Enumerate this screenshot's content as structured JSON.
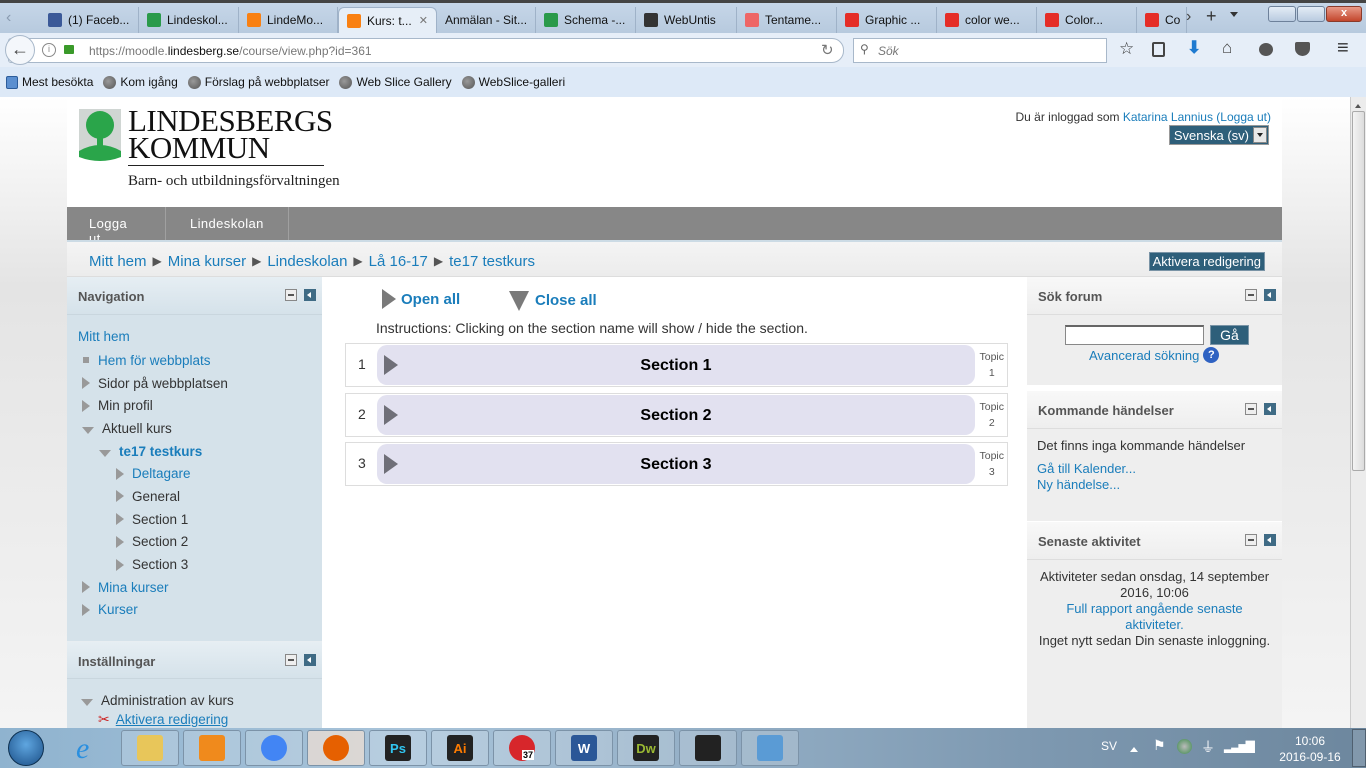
{
  "browser": {
    "tabs": [
      {
        "label": "(1) Faceb...",
        "icon": "facebook-icon",
        "color": "#3b5998"
      },
      {
        "label": "Lindeskol...",
        "icon": "lindesberg-tree-icon",
        "color": "#2a9a4a"
      },
      {
        "label": "LindeMo...",
        "icon": "moodle-icon",
        "color": "#f98012"
      },
      {
        "label": "Kurs: t...",
        "icon": "moodle-icon",
        "color": "#f98012",
        "active": true
      },
      {
        "label": "Anmälan - Sit...",
        "icon": "",
        "color": ""
      },
      {
        "label": "Schema -...",
        "icon": "lindesberg-tree-icon",
        "color": "#2a9a4a"
      },
      {
        "label": "WebUntis",
        "icon": "clock-icon",
        "color": "#333"
      },
      {
        "label": "Tentame...",
        "icon": "dots-icon",
        "color": "#e66"
      },
      {
        "label": "Graphic ...",
        "icon": "youtube-icon",
        "color": "#e52d27"
      },
      {
        "label": "color we...",
        "icon": "youtube-icon",
        "color": "#e52d27"
      },
      {
        "label": "Color...",
        "icon": "youtube-icon",
        "color": "#e52d27"
      },
      {
        "label": "Co",
        "icon": "youtube-icon",
        "color": "#e52d27"
      }
    ],
    "url_prefix": "https://moodle.",
    "url_domain": "lindesberg.se",
    "url_path": "/course/view.php?id=361",
    "search_placeholder": "Sök",
    "bookmarks": [
      "Mest besökta",
      "Kom igång",
      "Förslag på webbplatser",
      "Web Slice Gallery",
      "WebSlice-galleri"
    ]
  },
  "header": {
    "logo_line1": "LINDESBERGS",
    "logo_line2": "KOMMUN",
    "logo_sub": "Barn- och utbildningsförvaltningen",
    "login_prefix": "Du är inloggad som ",
    "user": "Katarina Lannius",
    "logout": "(Logga ut)",
    "language": "Svenska (sv)"
  },
  "menu": [
    "Logga ut",
    "Lindeskolan"
  ],
  "breadcrumb": [
    "Mitt hem",
    "Mina kurser",
    "Lindeskolan",
    "Lå 16-17",
    "te17 testkurs"
  ],
  "edit_button": "Aktivera redigering",
  "navigation": {
    "title": "Navigation",
    "root": "Mitt hem",
    "items": [
      {
        "label": "Hem för webbplats",
        "level": 1,
        "marker": "square",
        "link": true
      },
      {
        "label": "Sidor på webbplatsen",
        "level": 1,
        "marker": "right",
        "link": false
      },
      {
        "label": "Min profil",
        "level": 1,
        "marker": "right",
        "link": false
      },
      {
        "label": "Aktuell kurs",
        "level": 1,
        "marker": "down",
        "link": false
      },
      {
        "label": "te17 testkurs",
        "level": 2,
        "marker": "down",
        "link": true,
        "bold": true
      },
      {
        "label": "Deltagare",
        "level": 3,
        "marker": "right",
        "link": true
      },
      {
        "label": "General",
        "level": 3,
        "marker": "right",
        "link": false
      },
      {
        "label": "Section 1",
        "level": 3,
        "marker": "right",
        "link": false
      },
      {
        "label": "Section 2",
        "level": 3,
        "marker": "right",
        "link": false
      },
      {
        "label": "Section 3",
        "level": 3,
        "marker": "right",
        "link": false
      },
      {
        "label": "Mina kurser",
        "level": 1,
        "marker": "right",
        "link": true
      },
      {
        "label": "Kurser",
        "level": 1,
        "marker": "right",
        "link": true
      }
    ]
  },
  "settings": {
    "title": "Inställningar",
    "admin": "Administration av kurs",
    "edit": "Aktivera redigering"
  },
  "course": {
    "open_all": "Open all",
    "close_all": "Close all",
    "instructions": "Instructions: Clicking on the section name will show / hide the section.",
    "sections": [
      {
        "num": "1",
        "title": "Section 1",
        "topic": "Topic",
        "topic_num": "1"
      },
      {
        "num": "2",
        "title": "Section 2",
        "topic": "Topic",
        "topic_num": "2"
      },
      {
        "num": "3",
        "title": "Section 3",
        "topic": "Topic",
        "topic_num": "3"
      }
    ]
  },
  "search_forum": {
    "title": "Sök forum",
    "button": "Gå",
    "advanced": "Avancerad sökning"
  },
  "events": {
    "title": "Kommande händelser",
    "none": "Det finns inga kommande händelser",
    "calendar": "Gå till Kalender...",
    "new": "Ny händelse..."
  },
  "activity": {
    "title": "Senaste aktivitet",
    "since": "Aktiviteter sedan onsdag, 14 september 2016, 10:06",
    "report": "Full rapport angående senaste aktiviteter.",
    "nothing": "Inget nytt sedan Din senaste inloggning."
  },
  "taskbar": {
    "apps": [
      {
        "name": "explorer",
        "label": "",
        "color": "#e8c65a"
      },
      {
        "name": "media-player",
        "label": "",
        "color": "#f08a1c"
      },
      {
        "name": "chrome",
        "label": "",
        "color": "#4285f4"
      },
      {
        "name": "firefox",
        "label": "",
        "color": "#e66000"
      },
      {
        "name": "photoshop",
        "label": "Ps",
        "color": "#31c5f0"
      },
      {
        "name": "illustrator",
        "label": "Ai",
        "color": "#ff7c00"
      },
      {
        "name": "mail",
        "label": "37",
        "color": "#d7262b"
      },
      {
        "name": "word",
        "label": "W",
        "color": "#2b5797"
      },
      {
        "name": "dreamweaver",
        "label": "Dw",
        "color": "#9ab833"
      },
      {
        "name": "acrobat",
        "label": "",
        "color": "#c00"
      },
      {
        "name": "photo-viewer",
        "label": "",
        "color": "#5a9bd5"
      }
    ],
    "lang": "SV",
    "time": "10:06",
    "date": "2016-09-16"
  }
}
